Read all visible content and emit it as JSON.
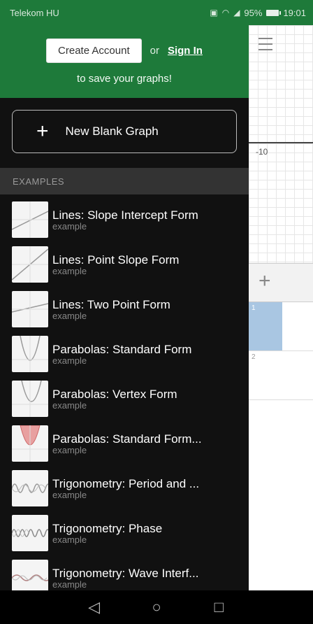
{
  "status_bar": {
    "carrier": "Telekom HU",
    "battery": "95%",
    "time": "19:01"
  },
  "drawer": {
    "create_account_label": "Create Account",
    "or_text": "or",
    "sign_in_label": "Sign In",
    "save_text": "to save your graphs!",
    "new_graph_label": "New Blank Graph",
    "examples_header": "EXAMPLES",
    "examples": [
      {
        "title": "Lines: Slope Intercept Form",
        "subtitle": "example",
        "thumb": "line-icon"
      },
      {
        "title": "Lines: Point Slope Form",
        "subtitle": "example",
        "thumb": "line-icon"
      },
      {
        "title": "Lines: Two Point Form",
        "subtitle": "example",
        "thumb": "line-icon"
      },
      {
        "title": "Parabolas: Standard Form",
        "subtitle": "example",
        "thumb": "parabola-icon"
      },
      {
        "title": "Parabolas: Vertex Form",
        "subtitle": "example",
        "thumb": "parabola-icon"
      },
      {
        "title": "Parabolas: Standard Form...",
        "subtitle": "example",
        "thumb": "parabola-filled-icon"
      },
      {
        "title": "Trigonometry: Period and ...",
        "subtitle": "example",
        "thumb": "wave-icon"
      },
      {
        "title": "Trigonometry: Phase",
        "subtitle": "example",
        "thumb": "wave-icon"
      },
      {
        "title": "Trigonometry: Wave Interf...",
        "subtitle": "example",
        "thumb": "wave-icon"
      }
    ]
  },
  "graph": {
    "axis_label": "-10",
    "expression_numbers": [
      "1",
      "2"
    ]
  },
  "colors": {
    "header_green": "#1e7a3a",
    "drawer_bg": "#111111",
    "selected_expr": "#a9c6e2"
  }
}
